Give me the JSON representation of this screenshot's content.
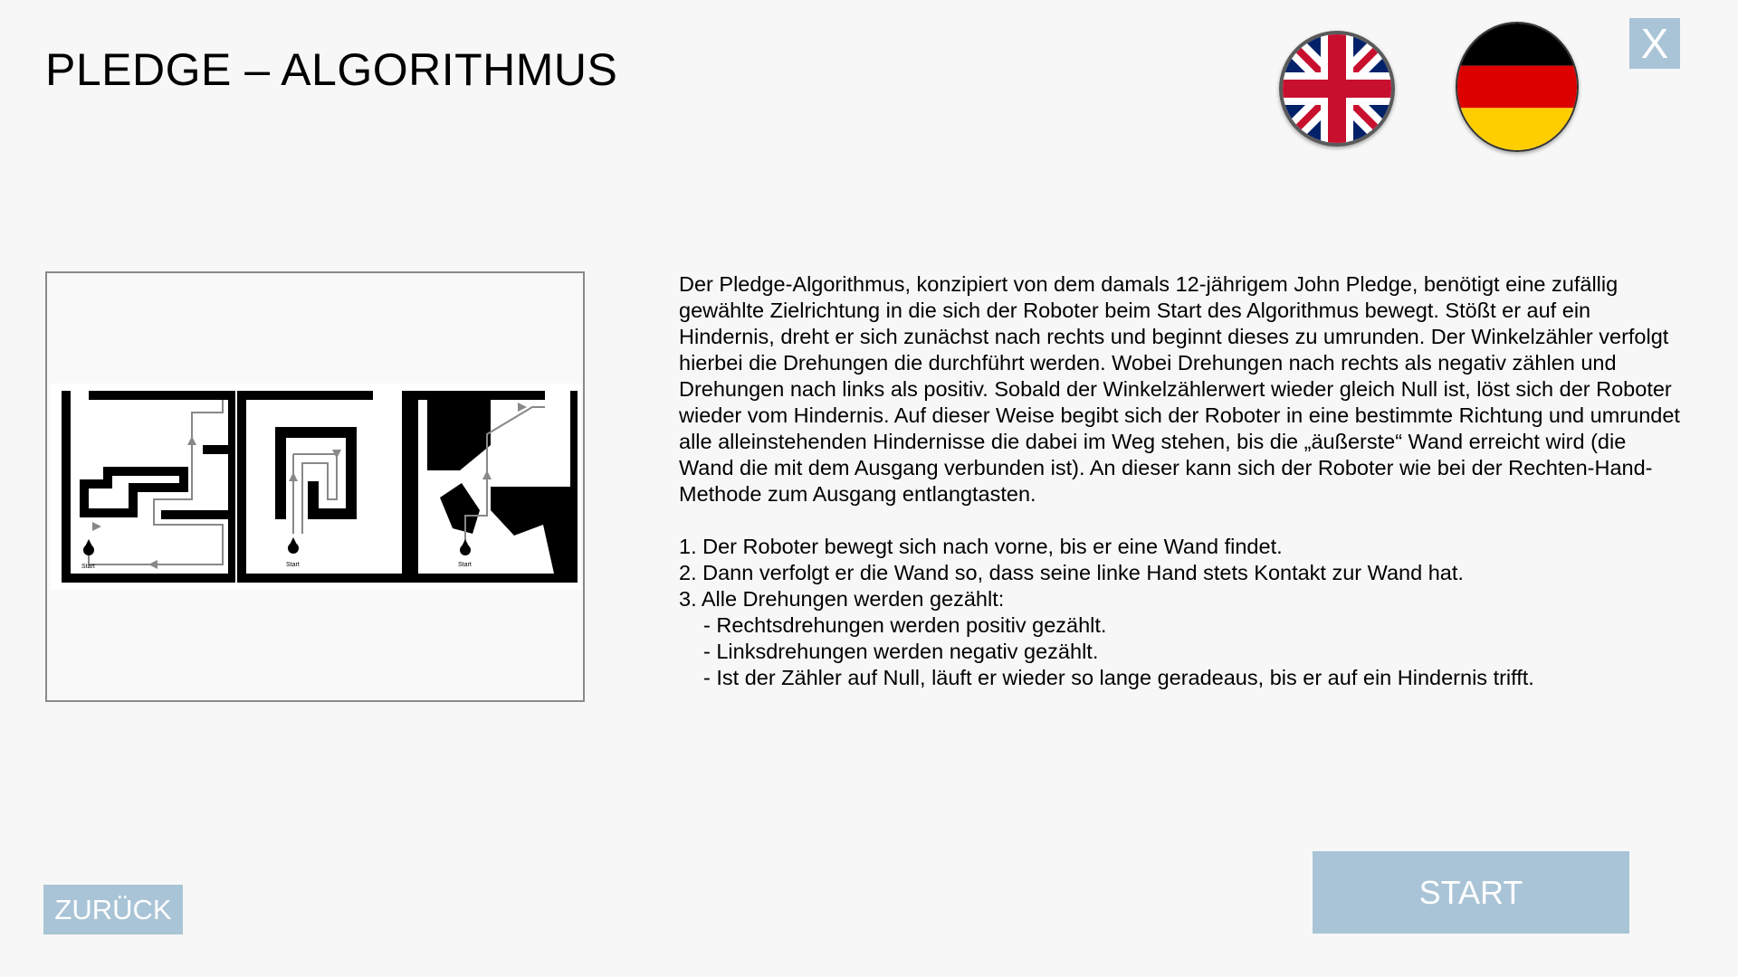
{
  "header": {
    "title": "PLEDGE – ALGORITHMUS"
  },
  "language": {
    "options": [
      {
        "name": "english-flag",
        "icon": "uk-flag-icon"
      },
      {
        "name": "german-flag",
        "icon": "germany-flag-icon"
      }
    ]
  },
  "close": {
    "label": "X"
  },
  "figure": {
    "start_labels": [
      "Start",
      "Start",
      "Start"
    ]
  },
  "description": {
    "paragraph": "Der Pledge-Algorithmus, konzipiert von dem damals 12-jährigem John Pledge, benötigt eine zufällig gewählte Zielrichtung in die sich der Roboter beim Start des Algorithmus bewegt. Stößt er auf ein Hindernis, dreht er sich zunächst nach rechts und beginnt dieses zu umrunden. Der Winkelzähler verfolgt hierbei die Drehungen die durchführt werden. Wobei Drehungen nach rechts als negativ zählen und Drehungen nach links als positiv. Sobald der Winkelzählerwert wieder gleich Null ist, löst sich der Roboter wieder vom Hindernis. Auf dieser Weise begibt sich der Roboter in eine bestimmte Richtung und umrundet alle alleinstehenden Hindernisse die dabei im Weg stehen, bis die „äußerste“ Wand erreicht wird (die Wand die mit dem Ausgang verbunden ist). An dieser kann sich der Roboter wie bei der Rechten-Hand-Methode zum Ausgang entlangtasten.",
    "steps": [
      "1. Der Roboter bewegt sich nach vorne, bis er eine Wand findet.",
      "2. Dann verfolgt er die Wand so, dass seine linke Hand stets Kontakt zur Wand hat.",
      "3. Alle Drehungen werden gezählt:"
    ],
    "substeps": [
      "- Rechtsdrehungen werden positiv gezählt.",
      "- Linksdrehungen werden negativ gezählt.",
      "- Ist der Zähler auf Null, läuft er wieder so lange geradeaus, bis er auf ein Hindernis trifft."
    ]
  },
  "footer": {
    "back_label": "ZURÜCK",
    "start_label": "START"
  },
  "colors": {
    "background": "#f7f7f7",
    "button": "#a9c4d6",
    "button_text": "#ffffff"
  }
}
